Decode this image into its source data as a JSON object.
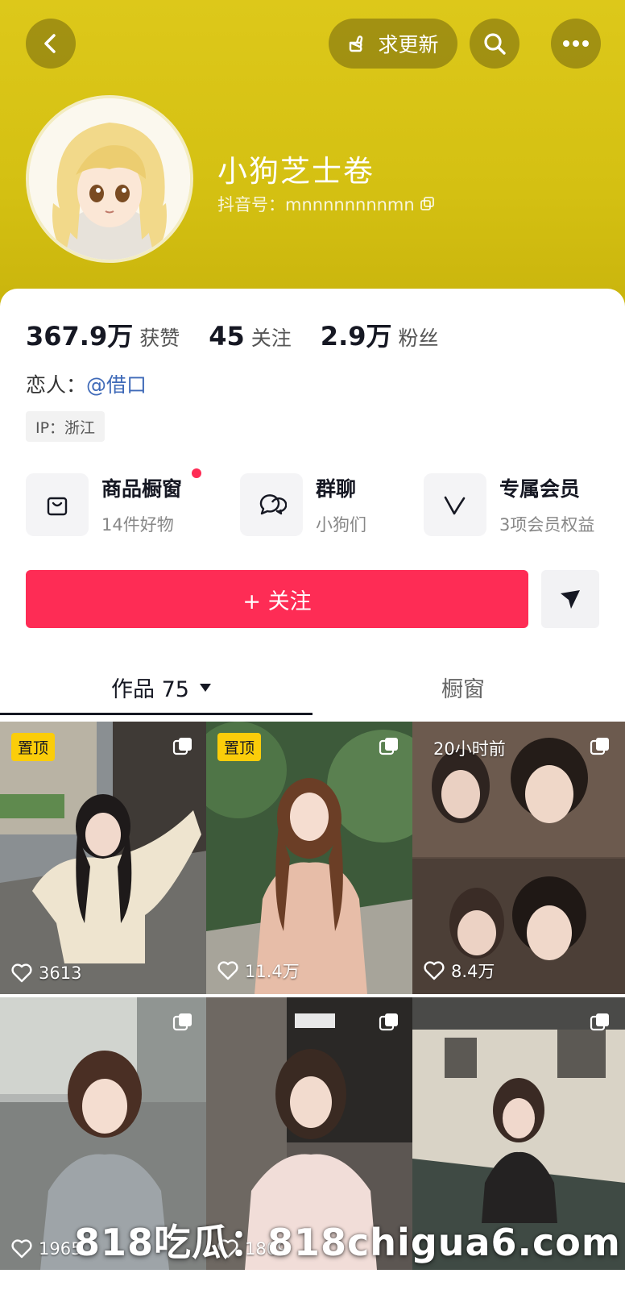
{
  "header": {
    "request_update_label": "求更新"
  },
  "profile": {
    "nickname": "小狗芝士卷",
    "douyin_id": "抖音号：mnnnnnnnnmn"
  },
  "stats": [
    {
      "value": "367.9万",
      "label": "获赞"
    },
    {
      "value": "45",
      "label": "关注"
    },
    {
      "value": "2.9万",
      "label": "粉丝"
    }
  ],
  "bio": {
    "lover_prefix": "恋人：",
    "lover_link": "@借口",
    "ip": "IP：浙江"
  },
  "services": [
    {
      "title": "商品橱窗",
      "sub": "14件好物"
    },
    {
      "title": "群聊",
      "sub": "小狗们"
    },
    {
      "title": "专属会员",
      "sub": "3项会员权益"
    }
  ],
  "actions": {
    "follow_label": "+ 关注"
  },
  "tabs": [
    {
      "label": "作品 75"
    },
    {
      "label": "橱窗"
    }
  ],
  "videos": [
    {
      "badge": "置顶",
      "likes": "3613"
    },
    {
      "badge": "置顶",
      "likes": "11.4万"
    },
    {
      "time": "20小时前",
      "likes": "8.4万"
    },
    {
      "likes": "1965"
    },
    {
      "likes": "1809"
    },
    {
      "likes": ""
    }
  ],
  "watermark": "818吃瓜：818chigua6.com",
  "colors": {
    "header_yellow": "#d4c012",
    "follow_red": "#fe2c55",
    "link_blue": "#3f6ab8",
    "pin_yellow": "#fbcd0a"
  }
}
